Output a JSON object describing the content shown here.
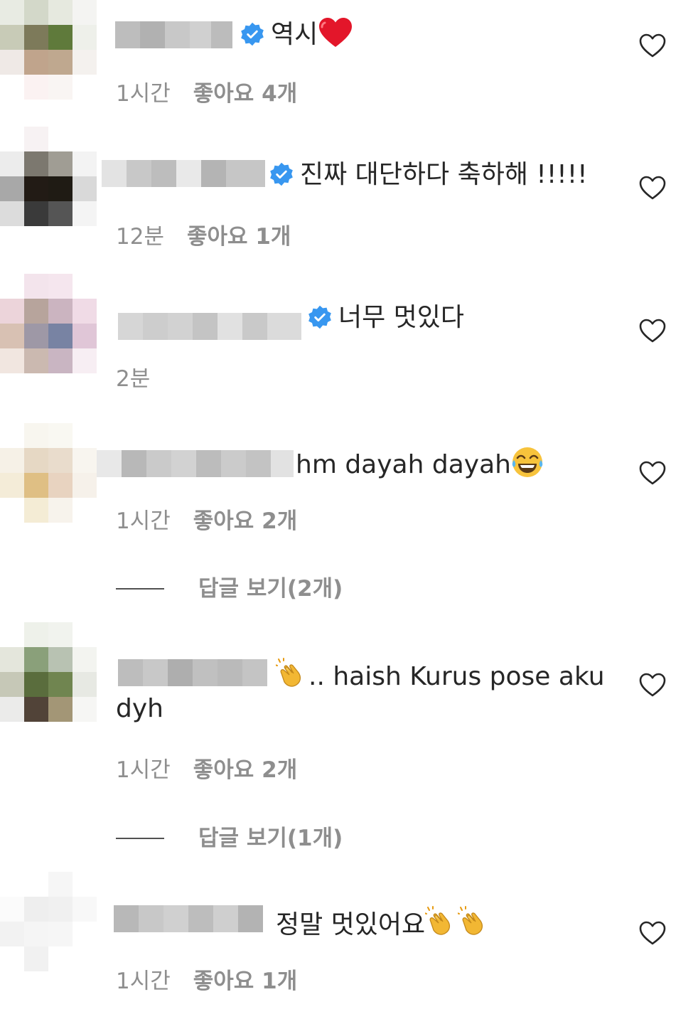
{
  "comments": [
    {
      "text": "역시",
      "verified": true,
      "time": "1시간",
      "likes": "좋아요 4개",
      "emoji": "heart"
    },
    {
      "text": "진짜 대단하다 축하해 !!!!!",
      "verified": true,
      "time": "12분",
      "likes": "좋아요 1개"
    },
    {
      "text": "너무 멋있다",
      "verified": true,
      "time": "2분"
    },
    {
      "text": "hm dayah dayah",
      "verified": false,
      "time": "1시간",
      "likes": "좋아요 2개",
      "emoji": "tears-of-joy",
      "replies": "답글 보기(2개)"
    },
    {
      "text": ".. haish Kurus pose aku",
      "text_line2": "dyh",
      "verified": false,
      "time": "1시간",
      "likes": "좋아요 2개",
      "emoji": "clapping-hands",
      "replies": "답글 보기(1개)"
    },
    {
      "text": "정말 멋있어요",
      "verified": false,
      "time": "1시간",
      "likes": "좋아요 1개",
      "emoji": "clapping-hands-x2"
    }
  ],
  "colors": {
    "text": "#262626",
    "meta": "#8e8e8e",
    "verified": "#3897f0"
  }
}
